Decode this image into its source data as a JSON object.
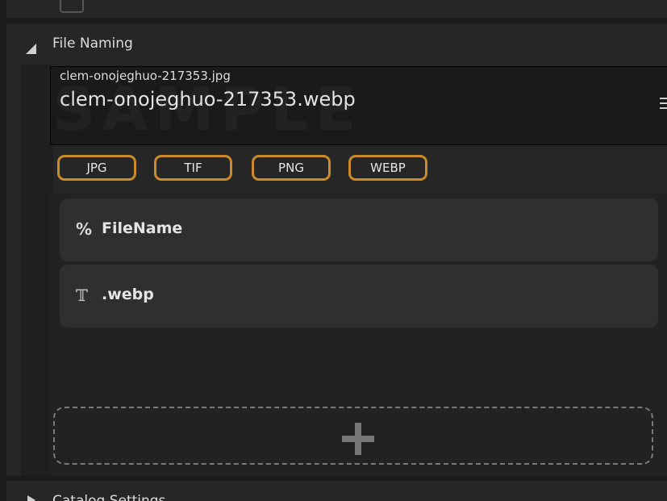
{
  "top_section": {
    "partial_title": ""
  },
  "file_naming": {
    "title": "File Naming",
    "source_filename": "clem-onojeghuo-217353.jpg",
    "result_filename": "clem-onojeghuo-217353.webp",
    "watermark_text": "SAMPLE",
    "menu_icon": "hamburger-menu-icon",
    "extensions": [
      "JPG",
      "TIF",
      "PNG",
      "WEBP"
    ],
    "accent_color": "#cc8a2a",
    "tokens": [
      {
        "icon": "percent-icon",
        "symbol": "%",
        "label": "FileName"
      },
      {
        "icon": "text-icon",
        "symbol": "𝕋",
        "label": ".webp"
      }
    ],
    "add_icon": "plus-icon"
  },
  "catalog": {
    "title": "Catalog Settings"
  }
}
